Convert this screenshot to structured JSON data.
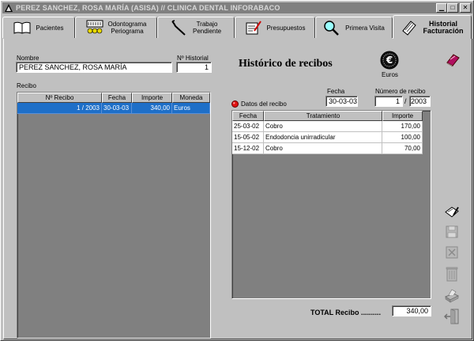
{
  "window": {
    "title": "PEREZ SANCHEZ, ROSA MARÍA (ASISA) // CLINICA DENTAL INFORABACO",
    "minimize_glyph": "▁",
    "maximize_glyph": "□",
    "close_glyph": "✕"
  },
  "tabs": [
    {
      "label": "Pacientes",
      "icon": "book-icon"
    },
    {
      "label": "Odontograma\nPeriograma",
      "icon": "teeth-chart-icon"
    },
    {
      "label": "Trabajo\nPendiente",
      "icon": "dental-tool-icon"
    },
    {
      "label": "Presupuestos",
      "icon": "writing-document-icon"
    },
    {
      "label": "Primera Visita",
      "icon": "magnifier-icon"
    },
    {
      "label": "Historial\nFacturación",
      "icon": "notepad-icon",
      "active": true
    }
  ],
  "patient": {
    "name_label": "Nombre",
    "name_value": "PEREZ SANCHEZ, ROSA MARÍA",
    "history_label": "Nº Historial",
    "history_value": "1"
  },
  "receipts": {
    "section_label": "Recibo",
    "columns": [
      "Nº Recibo",
      "Fecha",
      "Importe",
      "Moneda"
    ],
    "rows": [
      {
        "numero": "1 / 2003",
        "fecha": "30-03-03",
        "importe": "340,00",
        "moneda": "Euros",
        "selected": true
      }
    ]
  },
  "history": {
    "title": "Histórico de recibos",
    "currency_label": "Euros",
    "currency_symbol": "€",
    "details_label": "Datos del recibo",
    "date_label": "Fecha",
    "date_value": "30-03-03",
    "receipt_number_label": "Número de recibo",
    "receipt_number_value": "1",
    "receipt_separator": "/",
    "receipt_year_value": "2003",
    "columns": [
      "Fecha",
      "Tratamiento",
      "Importe"
    ],
    "rows": [
      {
        "fecha": "25-03-02",
        "tratamiento": "Cobro",
        "importe": "170,00"
      },
      {
        "fecha": "15-05-02",
        "tratamiento": "Endodoncia unirradicular",
        "importe": "100,00"
      },
      {
        "fecha": "15-12-02",
        "tratamiento": "Cobro",
        "importe": "70,00"
      }
    ],
    "total_label": "TOTAL Recibo ..........",
    "total_value": "340,00"
  },
  "toolbar": {
    "items": [
      "red-book-icon",
      "edit-icon",
      "save-icon",
      "cancel-icon",
      "trash-icon",
      "print-icon",
      "exit-door-icon"
    ]
  },
  "colors": {
    "selection": "#1e6fc8",
    "face": "#c0c0c0",
    "title_bar": "#808080",
    "grid_empty": "#808080"
  }
}
